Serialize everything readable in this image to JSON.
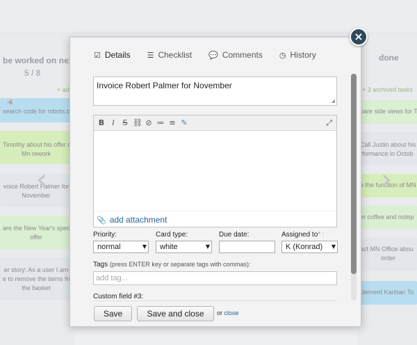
{
  "board": {
    "left_column": {
      "title": "be worked on next",
      "count": "5 / 8",
      "add_link": "+ add",
      "cards": [
        {
          "lines": [
            "search code for robots.txt"
          ],
          "badge": "-6"
        },
        {
          "lines": [
            "Timothy about his offer o",
            "Mn rework"
          ]
        },
        {
          "lines": [
            "voice Robert Palmer for",
            "November"
          ]
        },
        {
          "lines": [
            "are the New Year's spec",
            "offer"
          ]
        },
        {
          "lines": [
            "er story: As a user I am",
            "e to remove the items fro",
            "the basket"
          ]
        }
      ]
    },
    "right_column": {
      "title": "done",
      "archived_link": "+ 3 archived tasks",
      "cards": [
        {
          "lines": [
            "pare side views for T"
          ]
        },
        {
          "lines": [
            "Call Justin about his",
            "rformance in Octob"
          ]
        },
        {
          "lines": [
            "e the function of MN"
          ]
        },
        {
          "lines": [
            "er coffee and notep"
          ]
        },
        {
          "lines": [
            "act MN Office abou",
            "order"
          ]
        },
        {
          "lines": [
            "plement Kanban To"
          ]
        }
      ]
    }
  },
  "modal": {
    "tabs": [
      {
        "label": "Details",
        "icon": "check-square-icon"
      },
      {
        "label": "Checklist",
        "icon": "list-icon"
      },
      {
        "label": "Comments",
        "icon": "comment-icon"
      },
      {
        "label": "History",
        "icon": "clock-icon"
      }
    ],
    "title_value": "Invoice Robert Palmer for November",
    "attach_label": "add attachment",
    "priority": {
      "label": "Priority:",
      "value": "normal"
    },
    "card_type": {
      "label": "Card type:",
      "value": "white"
    },
    "due_date": {
      "label": "Due date:",
      "value": ""
    },
    "assigned": {
      "label": "Assigned to",
      "required_mark": "* :",
      "value": "K (Konrad)"
    },
    "tags": {
      "label": "Tags",
      "hint": "(press ENTER key or separate tags with commas):",
      "placeholder": "add tag..."
    },
    "custom_field": "Custom field #3:",
    "save_label": "Save",
    "save_close_label": "Save and close",
    "or_text": "or",
    "close_link": "close"
  },
  "colors": {
    "close_button": "#2d4a5a",
    "link": "#2a6496",
    "card_blue": "#9bd3ef",
    "card_green": "#c9ec9d"
  }
}
